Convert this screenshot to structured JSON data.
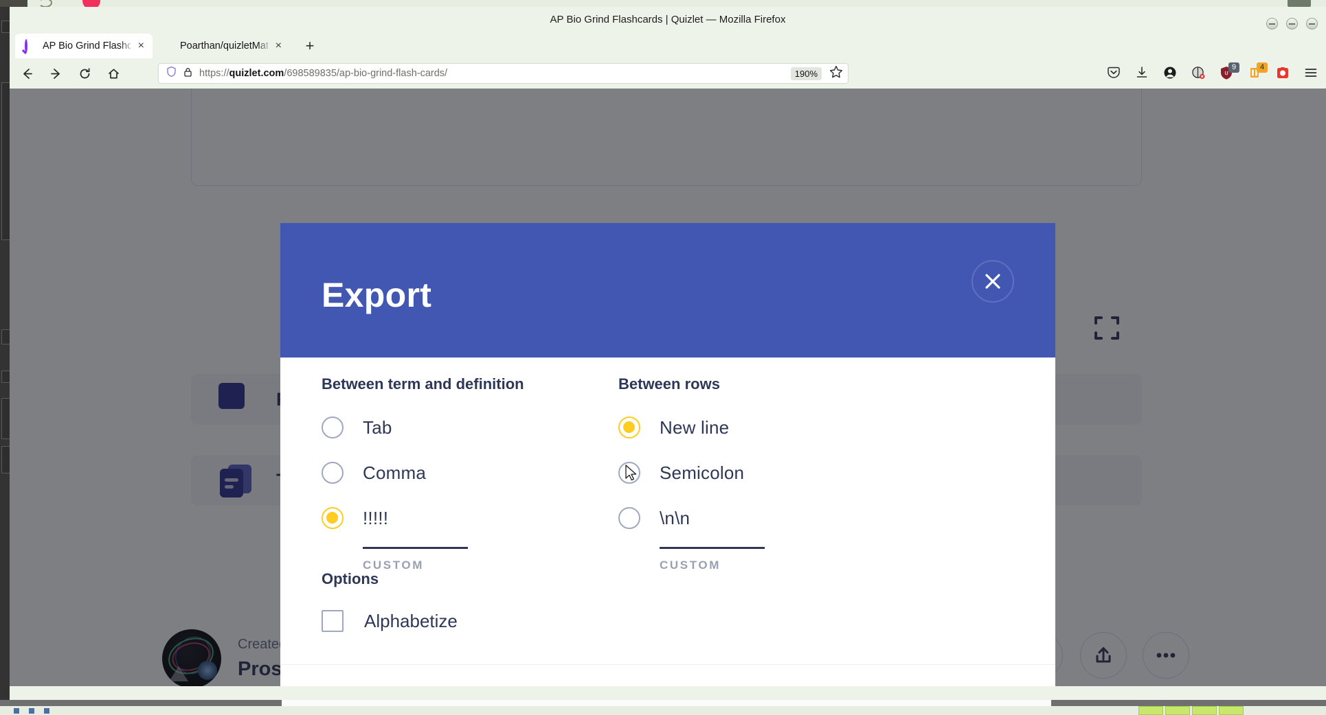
{
  "window": {
    "title": "AP Bio Grind Flashcards | Quizlet — Mozilla Firefox"
  },
  "tabs": [
    {
      "label": "AP Bio Grind Flashcards |",
      "favicon": "quizlet-q-icon",
      "active": true,
      "close": "×"
    },
    {
      "label": "Poarthan/quizletMatch: H",
      "favicon": "github-icon",
      "active": false,
      "close": "×"
    }
  ],
  "newtab": {
    "label": "+"
  },
  "nav": {
    "back_icon": "back-arrow-icon",
    "forward_icon": "forward-arrow-icon",
    "reload_icon": "reload-icon",
    "home_icon": "home-icon",
    "url": {
      "scheme": "https://",
      "host": "quizlet.com",
      "path": "/698589835/ap-bio-grind-flash-cards/"
    },
    "zoom_level": "190%",
    "bookmark_icon": "star-icon",
    "shield_icon": "shield-icon",
    "lock_icon": "padlock-icon"
  },
  "toolbar_icons": [
    {
      "name": "pocket-icon",
      "badge": ""
    },
    {
      "name": "downloads-icon",
      "badge": ""
    },
    {
      "name": "account-icon",
      "badge": ""
    },
    {
      "name": "privacy-badger-icon",
      "badge": ""
    },
    {
      "name": "ublock-origin-icon",
      "badge": "9"
    },
    {
      "name": "extension-icon",
      "badge": "4"
    },
    {
      "name": "screenshot-extension-icon",
      "badge": ""
    },
    {
      "name": "application-menu-icon",
      "badge": ""
    }
  ],
  "page_background": {
    "expand_icon": "fullscreen-icon",
    "menu_items": [
      {
        "label": "Fl",
        "icon": "flashcards-icon"
      },
      {
        "label": "Te",
        "icon": "test-icon"
      }
    ],
    "creator": {
      "created_by_label": "Created",
      "username": "Proski"
    },
    "actions": [
      {
        "name": "share-button",
        "icon": "share-icon"
      },
      {
        "name": "more-options-button",
        "icon": "ellipsis-icon"
      }
    ]
  },
  "modal": {
    "title": "Export",
    "close_label": "×",
    "columns": [
      {
        "heading": "Between term and definition",
        "options": [
          {
            "label": "Tab",
            "selected": false
          },
          {
            "label": "Comma",
            "selected": false
          },
          {
            "label": "!!!!!",
            "selected": true
          }
        ],
        "custom_label": "CUSTOM"
      },
      {
        "heading": "Between rows",
        "options": [
          {
            "label": "New line",
            "selected": true
          },
          {
            "label": "Semicolon",
            "selected": false
          },
          {
            "label": "\\n\\n",
            "selected": false
          }
        ],
        "custom_label": "CUSTOM"
      }
    ],
    "options_section": {
      "heading": "Options",
      "checkboxes": [
        {
          "label": "Alphabetize",
          "checked": false
        }
      ]
    }
  },
  "colors": {
    "modal_header": "#4257b2",
    "accent_yellow": "#ffcd1f",
    "text_dark": "#2e3856",
    "muted": "#9aa0b4",
    "chrome_bg": "#eef3e9"
  }
}
